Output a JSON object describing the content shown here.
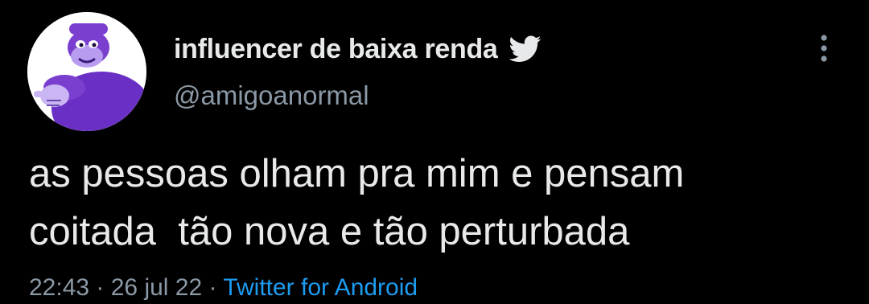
{
  "tweet": {
    "display_name": "influencer de baixa renda",
    "handle": "@amigoanormal",
    "text": "as pessoas olham pra mim e pensam\ncoitada  tão nova e tão perturbada",
    "time": "22:43",
    "separator": " · ",
    "date": "26 jul 22",
    "source": "Twitter for Android"
  },
  "icons": {
    "verified_badge": "twitter-bird-icon",
    "more": "more-vertical-icon",
    "avatar": "purple-gorilla-pointing"
  },
  "colors": {
    "background": "#000000",
    "text_primary": "#e7e9ea",
    "text_secondary": "#8b98a5",
    "accent": "#1d9bf0",
    "avatar_purple": "#7b3fd0"
  }
}
